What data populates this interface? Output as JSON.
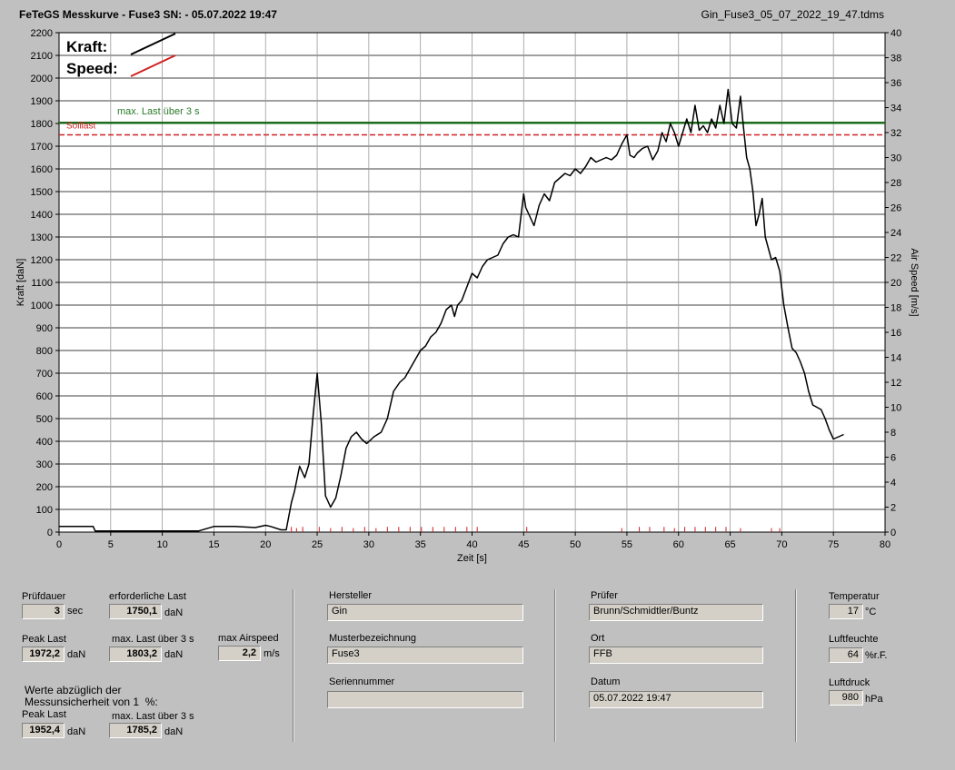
{
  "header": {
    "title": "FeTeGS Messkurve - Fuse3  SN:  - 05.07.2022 19:47",
    "file": "Gin_Fuse3_05_07_2022_19_47.tdms"
  },
  "chart_data": {
    "type": "line",
    "xlabel": "Zeit [s]",
    "ylabel": "Kraft [daN]",
    "y2label": "Air Speed [m/s]",
    "xlim": [
      0,
      80
    ],
    "ylim": [
      0,
      2200
    ],
    "y2lim": [
      0,
      40
    ],
    "xticks": [
      0,
      5,
      10,
      15,
      20,
      25,
      30,
      35,
      40,
      45,
      50,
      55,
      60,
      65,
      70,
      75,
      80
    ],
    "yticks": [
      0,
      100,
      200,
      300,
      400,
      500,
      600,
      700,
      800,
      900,
      1000,
      1100,
      1200,
      1300,
      1400,
      1500,
      1600,
      1700,
      1800,
      1900,
      2000,
      2100,
      2200
    ],
    "y2ticks": [
      0,
      2,
      4,
      6,
      8,
      10,
      12,
      14,
      16,
      18,
      20,
      22,
      24,
      26,
      28,
      30,
      32,
      34,
      36,
      38,
      40
    ],
    "grid": true,
    "legend": {
      "position": "top-left",
      "kraft_label": "Kraft:",
      "speed_label": "Speed:",
      "kraft_color": "#000000",
      "speed_color": "#d02020"
    },
    "reference_lines": [
      {
        "name": "max. Last über  3 s",
        "value": 1803.2,
        "color": "#1a6b1a",
        "style": "solid"
      },
      {
        "name": "Solllast",
        "value": 1750.1,
        "color": "#d02020",
        "style": "dashed"
      }
    ],
    "series": [
      {
        "name": "Kraft",
        "color": "#000000",
        "axis": "left",
        "x": [
          0,
          1,
          3.3,
          3.5,
          5,
          10,
          13.5,
          15,
          17,
          19,
          20,
          20.5,
          21.5,
          22,
          22.5,
          22.8,
          23.3,
          23.8,
          24.2,
          24.6,
          25,
          25.4,
          25.8,
          26.3,
          26.8,
          27.3,
          27.8,
          28.3,
          28.8,
          29.3,
          29.8,
          30.5,
          31.2,
          31.8,
          32.4,
          33,
          33.5,
          34,
          34.5,
          35,
          35.5,
          36,
          36.5,
          37,
          37.5,
          38,
          38.3,
          38.6,
          39,
          39.5,
          40,
          40.5,
          41,
          41.5,
          42,
          42.5,
          43,
          43.5,
          44,
          44.5,
          45,
          45.2,
          45.5,
          46,
          46.5,
          47,
          47.5,
          48,
          48.5,
          49,
          49.5,
          50,
          50.5,
          51,
          51.5,
          52,
          52.5,
          53,
          53.5,
          54,
          54.5,
          55,
          55.3,
          55.7,
          56,
          56.5,
          57,
          57.5,
          58,
          58.4,
          58.8,
          59.2,
          59.6,
          60,
          60.4,
          60.8,
          61.2,
          61.6,
          62,
          62.4,
          62.8,
          63.2,
          63.6,
          64,
          64.4,
          64.8,
          65.2,
          65.6,
          66,
          66.3,
          66.6,
          66.9,
          67.2,
          67.5,
          67.8,
          68.1,
          68.4,
          68.7,
          69,
          69.4,
          69.8,
          70.2,
          70.6,
          71,
          71.4,
          71.8,
          72.2,
          72.6,
          73,
          73.4,
          73.8,
          74.2,
          74.6,
          75,
          75.5,
          76
        ],
        "values": [
          25,
          25,
          25,
          5,
          5,
          5,
          5,
          25,
          25,
          20,
          30,
          25,
          10,
          10,
          130,
          180,
          290,
          240,
          300,
          510,
          700,
          480,
          160,
          110,
          150,
          250,
          370,
          420,
          440,
          410,
          390,
          420,
          440,
          500,
          620,
          660,
          680,
          720,
          760,
          800,
          820,
          860,
          880,
          920,
          980,
          1000,
          950,
          1000,
          1020,
          1080,
          1140,
          1120,
          1170,
          1200,
          1210,
          1220,
          1270,
          1300,
          1310,
          1300,
          1490,
          1430,
          1400,
          1350,
          1440,
          1490,
          1460,
          1540,
          1560,
          1580,
          1570,
          1600,
          1580,
          1610,
          1650,
          1630,
          1640,
          1650,
          1640,
          1660,
          1710,
          1750,
          1660,
          1650,
          1670,
          1690,
          1700,
          1640,
          1680,
          1760,
          1720,
          1800,
          1760,
          1700,
          1760,
          1820,
          1760,
          1880,
          1770,
          1790,
          1760,
          1820,
          1780,
          1880,
          1800,
          1950,
          1800,
          1780,
          1920,
          1780,
          1650,
          1600,
          1500,
          1350,
          1400,
          1470,
          1300,
          1250,
          1200,
          1210,
          1150,
          1000,
          900,
          810,
          790,
          750,
          700,
          620,
          560,
          550,
          540,
          500,
          450,
          410,
          420,
          430
        ]
      },
      {
        "name": "Speed",
        "color": "#d02020",
        "axis": "right",
        "x": [
          22.5,
          23,
          23.6,
          25.2,
          26.3,
          27.4,
          28.5,
          29.6,
          30.7,
          31.8,
          32.9,
          34,
          35.1,
          36.2,
          37.3,
          38.4,
          39.5,
          40.5,
          45.3,
          54.5,
          56.2,
          57.2,
          58.6,
          59.6,
          60.6,
          61.6,
          62.6,
          63.6,
          64.6,
          66,
          69,
          69.8
        ],
        "values": [
          0.2,
          0.1,
          0.2,
          0.2,
          0.1,
          0.2,
          0.1,
          0.2,
          0.1,
          0.2,
          0.2,
          0.2,
          0.2,
          0.2,
          0.2,
          0.2,
          0.2,
          0.2,
          0.2,
          0.1,
          0.2,
          0.2,
          0.2,
          0.1,
          0.2,
          0.2,
          0.2,
          0.2,
          0.2,
          0.1,
          0.1,
          0.1
        ]
      }
    ]
  },
  "panel": {
    "pruefdauer": {
      "label": "Prüfdauer",
      "value": "3",
      "unit": "sec"
    },
    "erforderliche_last": {
      "label": "erforderliche Last",
      "value": "1750,1",
      "unit": "daN"
    },
    "peak_last": {
      "label": "Peak Last",
      "value": "1972,2",
      "unit": "daN"
    },
    "max_last": {
      "label": "max. Last über  3 s",
      "value": "1803,2",
      "unit": "daN"
    },
    "max_airspeed": {
      "label": "max Airspeed",
      "value": "2,2",
      "unit": "m/s"
    },
    "werte_note": "Werte abzüglich der\nMessunsicherheit von 1  %:",
    "peak_last_corr": {
      "label": "Peak Last",
      "value": "1952,4",
      "unit": "daN"
    },
    "max_last_corr": {
      "label": "max. Last über  3 s",
      "value": "1785,2",
      "unit": "daN"
    },
    "hersteller": {
      "label": "Hersteller",
      "value": "Gin"
    },
    "musterbezeichnung": {
      "label": "Musterbezeichnung",
      "value": "Fuse3"
    },
    "seriennummer": {
      "label": "Seriennummer",
      "value": ""
    },
    "pruefer": {
      "label": "Prüfer",
      "value": "Brunn/Schmidtler/Buntz"
    },
    "ort": {
      "label": "Ort",
      "value": "FFB"
    },
    "datum": {
      "label": "Datum",
      "value": "05.07.2022 19:47"
    },
    "temperatur": {
      "label": "Temperatur",
      "value": "17",
      "unit": "°C"
    },
    "luftfeuchte": {
      "label": "Luftfeuchte",
      "value": "64",
      "unit": "%r.F."
    },
    "luftdruck": {
      "label": "Luftdruck",
      "value": "980",
      "unit": "hPa"
    }
  }
}
